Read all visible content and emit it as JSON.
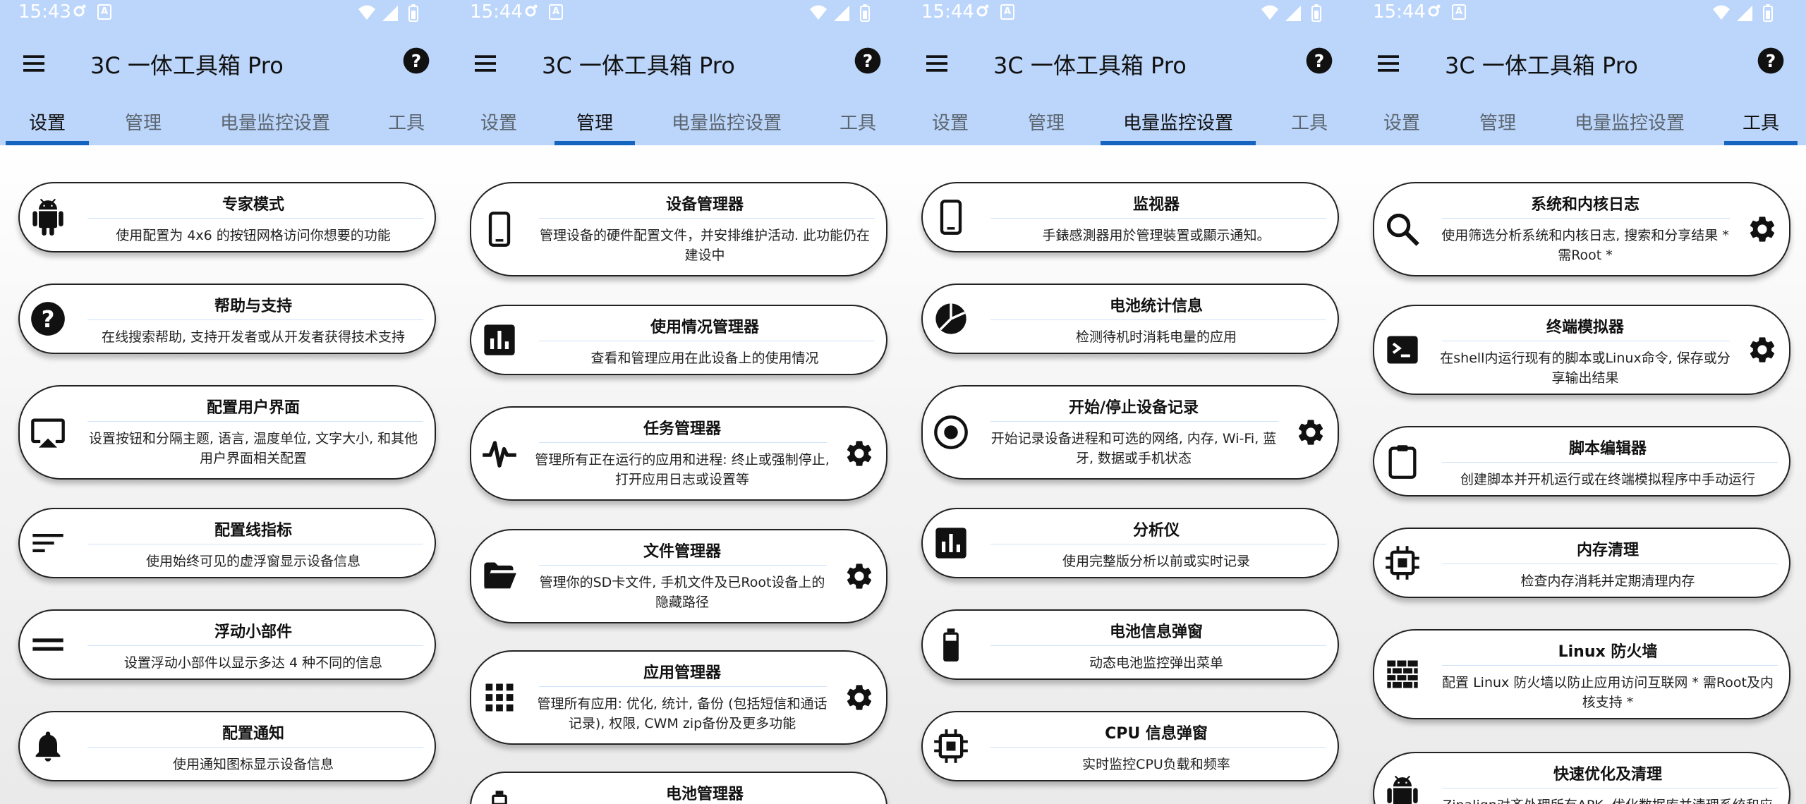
{
  "colors": {
    "header_bg": "#bcd6fb",
    "tab_indicator": "#1565c0",
    "card_bg": "#ffffff"
  },
  "screens": [
    {
      "status": {
        "time": "15:43"
      },
      "app_title": "3C 一体工具箱 Pro",
      "tabs": [
        "设置",
        "管理",
        "电量监控设置",
        "工具"
      ],
      "active_tab": 0,
      "cards": [
        {
          "icon": "android-icon",
          "title": "专家模式",
          "desc": "使用配置为 4x6 的按钮网格访问你想要的功能",
          "gear": false
        },
        {
          "icon": "help-icon",
          "title": "帮助与支持",
          "desc": "在线搜索帮助, 支持开发者或从开发者获得技术支持",
          "gear": false
        },
        {
          "icon": "cast-icon",
          "title": "配置用户界面",
          "desc": "设置按钮和分隔主题, 语言, 温度单位, 文字大小, 和其他用户界面相关配置",
          "gear": false
        },
        {
          "icon": "lines-icon",
          "title": "配置线指标",
          "desc": "使用始终可见的虚浮窗显示设备信息",
          "gear": false
        },
        {
          "icon": "equal-icon",
          "title": "浮动小部件",
          "desc": "设置浮动小部件以显示多达 4 种不同的信息",
          "gear": false
        },
        {
          "icon": "bell-icon",
          "title": "配置通知",
          "desc": "使用通知图标显示设备信息",
          "gear": false
        }
      ]
    },
    {
      "status": {
        "time": "15:44"
      },
      "app_title": "3C 一体工具箱 Pro",
      "tabs": [
        "设置",
        "管理",
        "电量监控设置",
        "工具"
      ],
      "active_tab": 1,
      "cards": [
        {
          "icon": "phone-icon",
          "title": "设备管理器",
          "desc": "管理设备的硬件配置文件，并安排维护活动. 此功能仍在建设中",
          "gear": false
        },
        {
          "icon": "bar-chart-icon",
          "title": "使用情况管理器",
          "desc": "查看和管理应用在此设备上的使用情况",
          "gear": false
        },
        {
          "icon": "pulse-icon",
          "title": "任务管理器",
          "desc": "管理所有正在运行的应用和进程: 终止或强制停止, 打开应用日志或设置等",
          "gear": true
        },
        {
          "icon": "folder-icon",
          "title": "文件管理器",
          "desc": "管理你的SD卡文件, 手机文件及已Root设备上的隐藏路径",
          "gear": true
        },
        {
          "icon": "grid-icon",
          "title": "应用管理器",
          "desc": "管理所有应用: 优化, 统计, 备份 (包括短信和通话记录), 权限, CWM zip备份及更多功能",
          "gear": true
        },
        {
          "icon": "battery-icon",
          "title": "电池管理器",
          "desc": "",
          "gear": false
        }
      ]
    },
    {
      "status": {
        "time": "15:44"
      },
      "app_title": "3C 一体工具箱 Pro",
      "tabs": [
        "设置",
        "管理",
        "电量监控设置",
        "工具"
      ],
      "active_tab": 2,
      "cards": [
        {
          "icon": "phone-icon",
          "title": "监视器",
          "desc": "手錶感測器用於管理裝置或顯示通知。",
          "gear": false
        },
        {
          "icon": "pie-icon",
          "title": "电池统计信息",
          "desc": "检测待机时消耗电量的应用",
          "gear": false
        },
        {
          "icon": "record-icon",
          "title": "开始/停止设备记录",
          "desc": "开始记录设备进程和可选的网络, 内存, Wi-Fi, 蓝牙, 数据或手机状态",
          "gear": true
        },
        {
          "icon": "bar-chart-icon",
          "title": "分析仪",
          "desc": "使用完整版分析以前或实时记录",
          "gear": false
        },
        {
          "icon": "battery-icon",
          "title": "电池信息弹窗",
          "desc": "动态电池监控弹出菜单",
          "gear": false
        },
        {
          "icon": "chip-icon",
          "title": "CPU 信息弹窗",
          "desc": "实时监控CPU负载和频率",
          "gear": false
        }
      ]
    },
    {
      "status": {
        "time": "15:44"
      },
      "app_title": "3C 一体工具箱 Pro",
      "tabs": [
        "设置",
        "管理",
        "电量监控设置",
        "工具"
      ],
      "active_tab": 3,
      "cards": [
        {
          "icon": "search-icon",
          "title": "系统和内核日志",
          "desc": "使用筛选分析系统和内核日志, 搜索和分享结果 * 需Root *",
          "gear": true
        },
        {
          "icon": "terminal-icon",
          "title": "终端模拟器",
          "desc": "在shell内运行现有的脚本或Linux命令, 保存或分享输出结果",
          "gear": true
        },
        {
          "icon": "clipboard-icon",
          "title": "脚本编辑器",
          "desc": "创建脚本并开机运行或在终端模拟程序中手动运行",
          "gear": false
        },
        {
          "icon": "chip-icon",
          "title": "内存清理",
          "desc": "检查内存消耗并定期清理内存",
          "gear": false
        },
        {
          "icon": "firewall-icon",
          "title": "Linux 防火墙",
          "desc": "配置 Linux 防火墙以防止应用访问互联网 * 需Root及内核支持 *",
          "gear": false
        },
        {
          "icon": "android-icon",
          "title": "快速优化及清理",
          "desc": "Zipalign对齐处理所有APK, 优化数据库并清理系统和应用",
          "gear": false
        }
      ]
    }
  ]
}
